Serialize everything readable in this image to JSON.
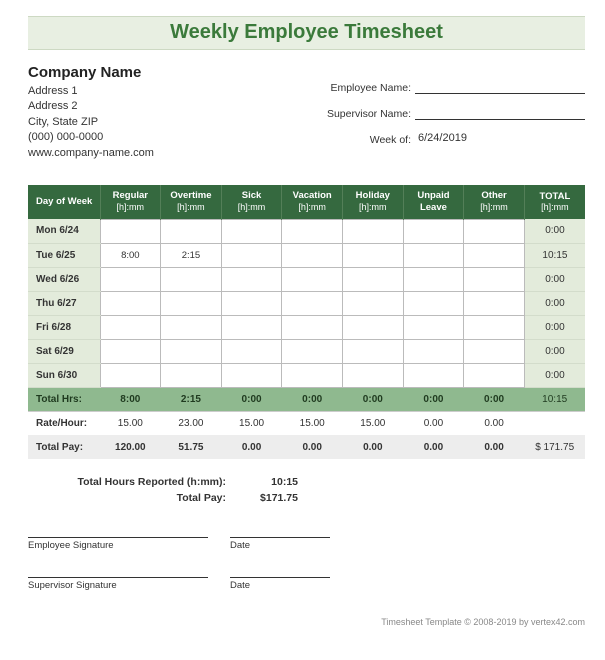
{
  "title": "Weekly Employee Timesheet",
  "company": {
    "name": "Company Name",
    "addr1": "Address 1",
    "addr2": "Address 2",
    "citystate": "City, State  ZIP",
    "phone": "(000) 000-0000",
    "website": "www.company-name.com"
  },
  "meta": {
    "employee_label": "Employee Name:",
    "employee_value": "",
    "supervisor_label": "Supervisor Name:",
    "supervisor_value": "",
    "week_label": "Week of:",
    "week_value": "6/24/2019"
  },
  "columns": {
    "day": "Day of Week",
    "regular": "Regular",
    "overtime": "Overtime",
    "sick": "Sick",
    "vacation": "Vacation",
    "holiday": "Holiday",
    "unpaid": "Unpaid Leave",
    "other": "Other",
    "total": "TOTAL",
    "unit": "[h]:mm"
  },
  "rows": [
    {
      "day": "Mon 6/24",
      "regular": "",
      "overtime": "",
      "sick": "",
      "vacation": "",
      "holiday": "",
      "unpaid": "",
      "other": "",
      "total": "0:00"
    },
    {
      "day": "Tue 6/25",
      "regular": "8:00",
      "overtime": "2:15",
      "sick": "",
      "vacation": "",
      "holiday": "",
      "unpaid": "",
      "other": "",
      "total": "10:15"
    },
    {
      "day": "Wed 6/26",
      "regular": "",
      "overtime": "",
      "sick": "",
      "vacation": "",
      "holiday": "",
      "unpaid": "",
      "other": "",
      "total": "0:00"
    },
    {
      "day": "Thu 6/27",
      "regular": "",
      "overtime": "",
      "sick": "",
      "vacation": "",
      "holiday": "",
      "unpaid": "",
      "other": "",
      "total": "0:00"
    },
    {
      "day": "Fri 6/28",
      "regular": "",
      "overtime": "",
      "sick": "",
      "vacation": "",
      "holiday": "",
      "unpaid": "",
      "other": "",
      "total": "0:00"
    },
    {
      "day": "Sat 6/29",
      "regular": "",
      "overtime": "",
      "sick": "",
      "vacation": "",
      "holiday": "",
      "unpaid": "",
      "other": "",
      "total": "0:00"
    },
    {
      "day": "Sun 6/30",
      "regular": "",
      "overtime": "",
      "sick": "",
      "vacation": "",
      "holiday": "",
      "unpaid": "",
      "other": "",
      "total": "0:00"
    }
  ],
  "totals": {
    "label": "Total Hrs:",
    "regular": "8:00",
    "overtime": "2:15",
    "sick": "0:00",
    "vacation": "0:00",
    "holiday": "0:00",
    "unpaid": "0:00",
    "other": "0:00",
    "total": "10:15"
  },
  "rate": {
    "label": "Rate/Hour:",
    "regular": "15.00",
    "overtime": "23.00",
    "sick": "15.00",
    "vacation": "15.00",
    "holiday": "15.00",
    "unpaid": "0.00",
    "other": "0.00",
    "total": ""
  },
  "pay": {
    "label": "Total Pay:",
    "regular": "120.00",
    "overtime": "51.75",
    "sick": "0.00",
    "vacation": "0.00",
    "holiday": "0.00",
    "unpaid": "0.00",
    "other": "0.00",
    "total": "$   171.75"
  },
  "summary": {
    "hours_label": "Total Hours Reported (h:mm):",
    "hours_value": "10:15",
    "pay_label": "Total Pay:",
    "pay_value": "$171.75"
  },
  "signatures": {
    "emp": "Employee Signature",
    "sup": "Supervisor Signature",
    "date": "Date"
  },
  "footer": "Timesheet Template © 2008-2019 by vertex42.com"
}
